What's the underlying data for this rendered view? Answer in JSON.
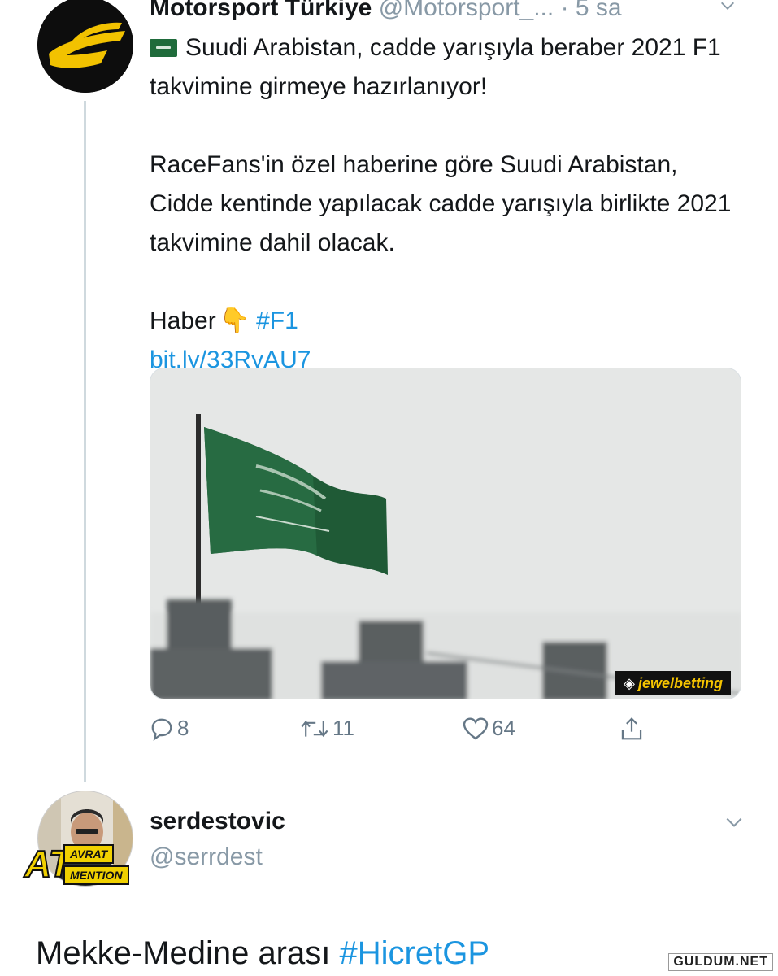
{
  "tweet": {
    "author_name": "Motorsport Türkiye",
    "author_handle": "@Motorsport_...",
    "time": "· 5 sa",
    "line1": "Suudi Arabistan, cadde yarışıyla beraber 2021 F1 takvimine girmeye hazırlanıyor!",
    "line2": "RaceFans'in özel haberine göre Suudi Arabistan, Cidde kentinde yapılacak cadde yarışıyla birlikte 2021 takvimine dahil olacak.",
    "haber_label": "Haber",
    "hashtag": "#F1",
    "link": "bit.ly/33RyAU7",
    "media_watermark": "jewelbetting",
    "actions": {
      "replies": "8",
      "retweets": "11",
      "likes": "64"
    }
  },
  "reply": {
    "author_name": "serdestovic",
    "author_handle": "@serrdest",
    "badge_big": "AT",
    "badge_top": "AVRAT",
    "badge_bottom": "MENTION",
    "text": "Mekke-Medine arası",
    "hashtag": "#HicretGP"
  },
  "site_watermark": "GULDUM.NET",
  "colors": {
    "link": "#1b95e0",
    "secondary": "#8899a6",
    "flag_green": "#1f6b3b",
    "brand_yellow": "#f2c200"
  },
  "icons": {
    "reply": "reply-icon",
    "retweet": "retweet-icon",
    "like": "heart-icon",
    "share": "share-icon",
    "menu": "chevron-down-icon",
    "flag": "saudi-flag-icon",
    "hand": "pointing-down-hand-icon"
  }
}
